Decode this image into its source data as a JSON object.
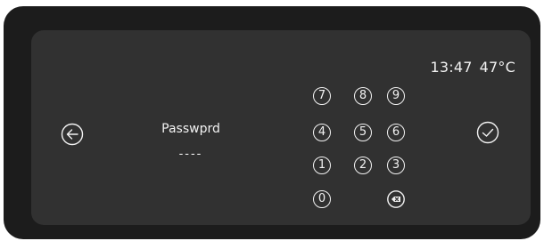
{
  "status": {
    "time": "13:47",
    "temperature": "47°C"
  },
  "password": {
    "label": "Passwprd",
    "masked_value": "----"
  },
  "keypad": {
    "rows": [
      [
        "7",
        "8",
        "9"
      ],
      [
        "4",
        "5",
        "6"
      ],
      [
        "1",
        "2",
        "3"
      ],
      [
        "0"
      ]
    ],
    "delete_icon": "backspace-icon"
  },
  "navigation": {
    "back_icon": "arrow-left-circle-icon",
    "confirm_icon": "check-circle-icon"
  }
}
